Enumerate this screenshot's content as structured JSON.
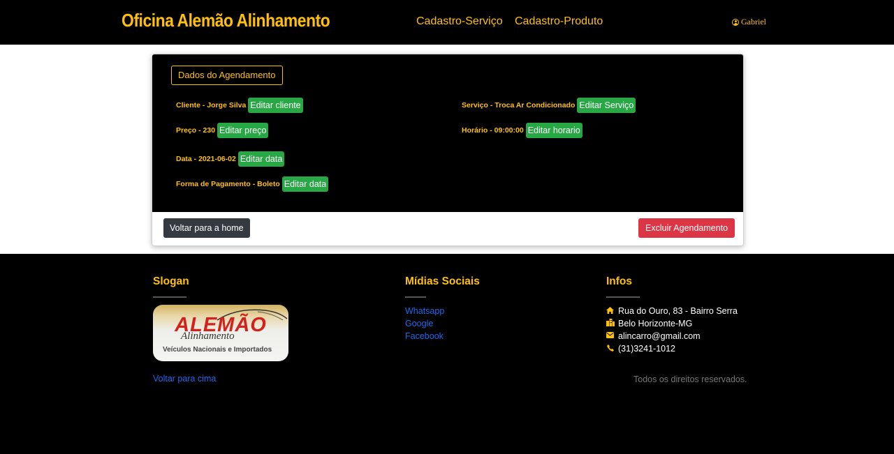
{
  "navbar": {
    "brand": "Oficina Alemão Alinhamento",
    "links": [
      "Cadastro-Serviço",
      "Cadastro-Produto"
    ],
    "user": "Gabriel"
  },
  "card": {
    "title": "Dados do Agendamento",
    "cliente": {
      "label": "Cliente - Jorge Silva",
      "button": "Editar cliente"
    },
    "servico": {
      "label": "Serviço - Troca Ar Condicionado",
      "button": "Editar Serviço"
    },
    "preco": {
      "label": "Preço - 230",
      "button": "Editar preço"
    },
    "horario": {
      "label": "Horário - 09:00:00",
      "button": "Editar horario"
    },
    "data": {
      "label": "Data - 2021-06-02",
      "button": "Editar data"
    },
    "pagamento": {
      "label": "Forma de Pagamento - Boleto",
      "button": "Editar data"
    },
    "back_button": "Voltar para a home",
    "delete_button": "Excluir Agendamento"
  },
  "footer": {
    "slogan_title": "Slogan",
    "logo": {
      "main": "ALEMÃO",
      "script": "Alinhamento",
      "sub": "Veículos Nacionais e Importados"
    },
    "back_to_top": "Voltar para cima",
    "social_title": "Mídias Sociais",
    "social_links": [
      "Whatsapp",
      "Google",
      "Facebook"
    ],
    "infos_title": "Infos",
    "infos": {
      "address": "Rua do Ouro, 83 - Bairro Serra",
      "city": "Belo Horizonte-MG",
      "email": "alincarro@gmail.com",
      "phone": "(31)3241-1012"
    },
    "rights": "Todos os direitos reservados."
  },
  "colors": {
    "accent": "#ffc107",
    "green": "#28a745",
    "red": "#dc3545",
    "dark": "#343a40",
    "link": "#1a6bf0"
  },
  "icons": [
    "user-circle-icon",
    "home-icon",
    "city-icon",
    "envelope-icon",
    "phone-icon"
  ]
}
